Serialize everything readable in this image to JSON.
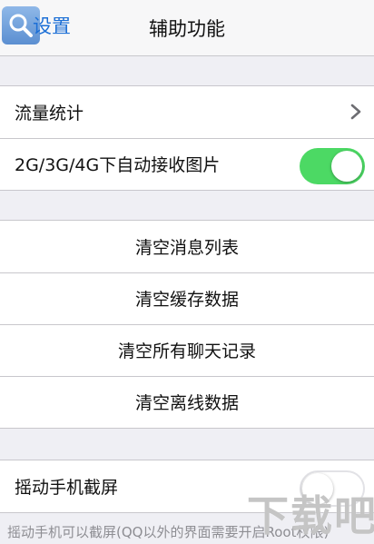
{
  "navbar": {
    "back_label": "设置",
    "title": "辅助功能"
  },
  "group1": {
    "traffic_stats_label": "流量统计",
    "auto_receive_label": "2G/3G/4G下自动接收图片",
    "auto_receive_on": true
  },
  "group2": {
    "items": [
      "清空消息列表",
      "清空缓存数据",
      "清空所有聊天记录",
      "清空离线数据"
    ]
  },
  "group3": {
    "shake_screenshot_label": "摇动手机截屏",
    "shake_screenshot_on": false
  },
  "footer_note": "摇动手机可以截屏(QQ以外的界面需要开启Root权限)",
  "watermark": "下载吧",
  "colors": {
    "accent": "#1c6fd6",
    "toggle_on": "#4cd964"
  }
}
